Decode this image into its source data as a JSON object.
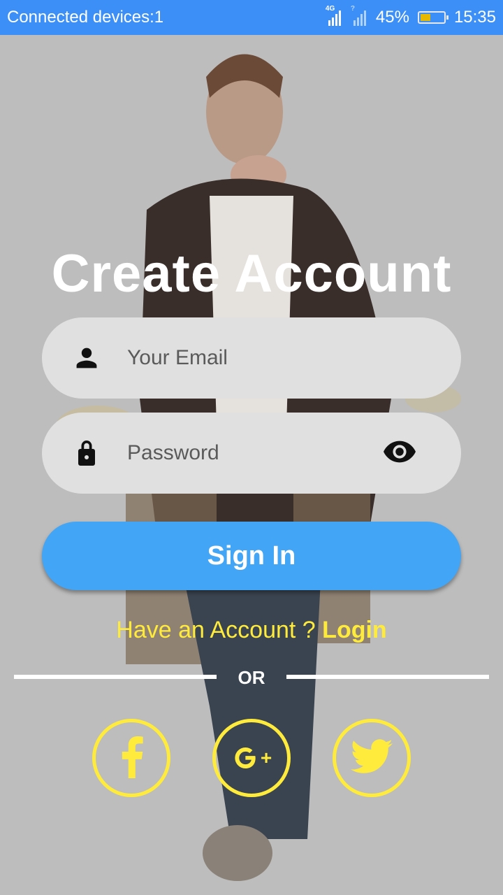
{
  "status_bar": {
    "left_text": "Connected devices:1",
    "network_label": "4G",
    "sim2_label": "?",
    "battery_percent": "45%",
    "battery_level": 0.45,
    "time": "15:35"
  },
  "colors": {
    "status_bar": "#3d8ff8",
    "primary_button": "#42a5f5",
    "accent_yellow": "#ffeb3b",
    "field_bg": "#e0e0e0"
  },
  "title": "Create Account",
  "email_field": {
    "placeholder": "Your Email",
    "icon": "person-icon"
  },
  "password_field": {
    "placeholder": "Password",
    "icon": "lock-icon",
    "toggle_icon": "eye-icon"
  },
  "sign_in_label": "Sign In",
  "have_account": {
    "prompt": "Have an Account ? ",
    "link": "Login"
  },
  "divider_label": "OR",
  "social": [
    {
      "name": "facebook",
      "icon": "facebook-icon"
    },
    {
      "name": "google-plus",
      "icon": "google-plus-icon",
      "label": "G+"
    },
    {
      "name": "twitter",
      "icon": "twitter-icon"
    }
  ]
}
